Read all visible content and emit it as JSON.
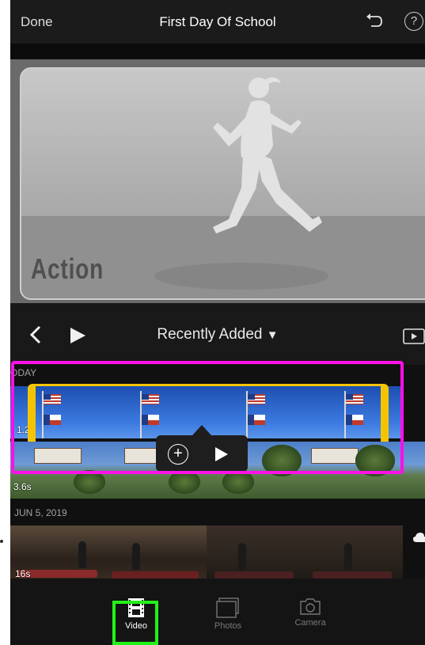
{
  "header": {
    "done_label": "Done",
    "title": "First Day Of School",
    "help_label": "?"
  },
  "preview": {
    "theme_title": "Action"
  },
  "browser": {
    "source_label": "Recently Added",
    "dropdown_arrow": "▼"
  },
  "groups": [
    {
      "label": "ODAY",
      "clips": [
        {
          "duration": "1.2s",
          "selected": true
        },
        {
          "duration": "3.6s"
        }
      ]
    },
    {
      "label": "JUN 5, 2019",
      "clips": [
        {
          "duration": "16s"
        }
      ]
    }
  ],
  "popover": {
    "add_symbol": "+"
  },
  "tabs": [
    {
      "label": "Video",
      "selected": true
    },
    {
      "label": "Photos"
    },
    {
      "label": "Camera"
    }
  ],
  "colors": {
    "selection_yellow": "#f4c400",
    "magenta_highlight": "#ff10e8",
    "green_highlight": "#21f21a"
  }
}
